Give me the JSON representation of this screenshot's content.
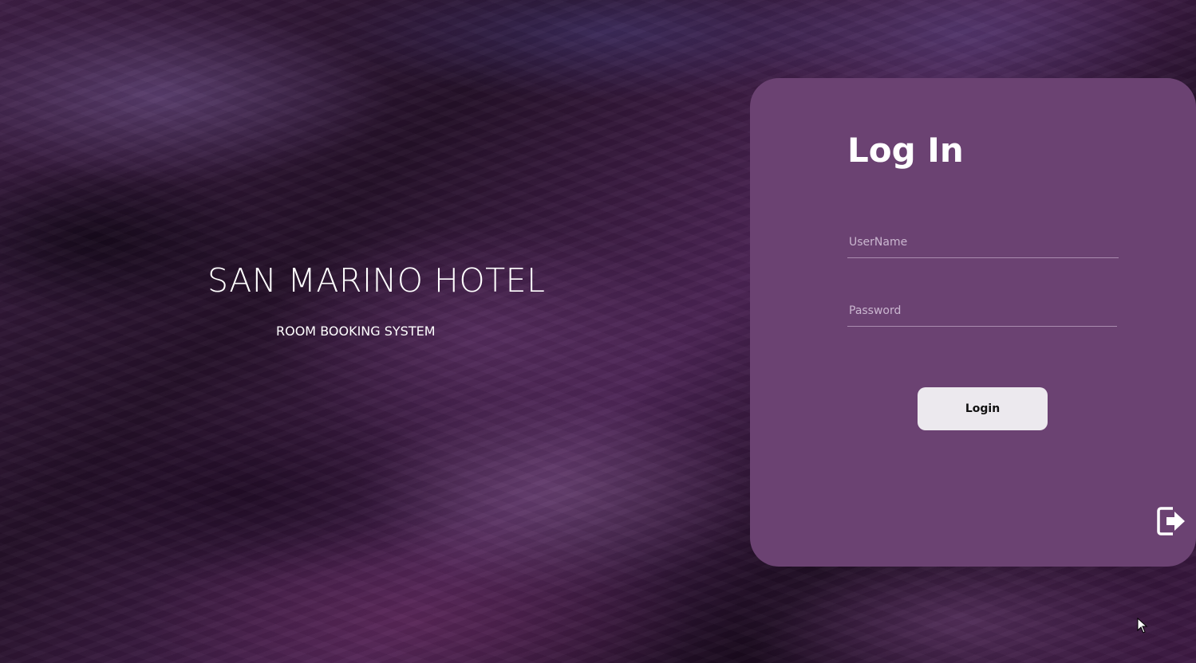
{
  "brand": {
    "title": "SAN MARINO HOTEL",
    "subtitle": "ROOM BOOKING SYSTEM"
  },
  "login": {
    "title": "Log In",
    "username": {
      "placeholder": "UserName",
      "value": ""
    },
    "password": {
      "placeholder": "Password",
      "value": ""
    },
    "button_label": "Login",
    "exit_icon": "exit-icon"
  },
  "colors": {
    "panel": "#6b4272",
    "button": "#ece9ee",
    "text": "#ffffff"
  }
}
